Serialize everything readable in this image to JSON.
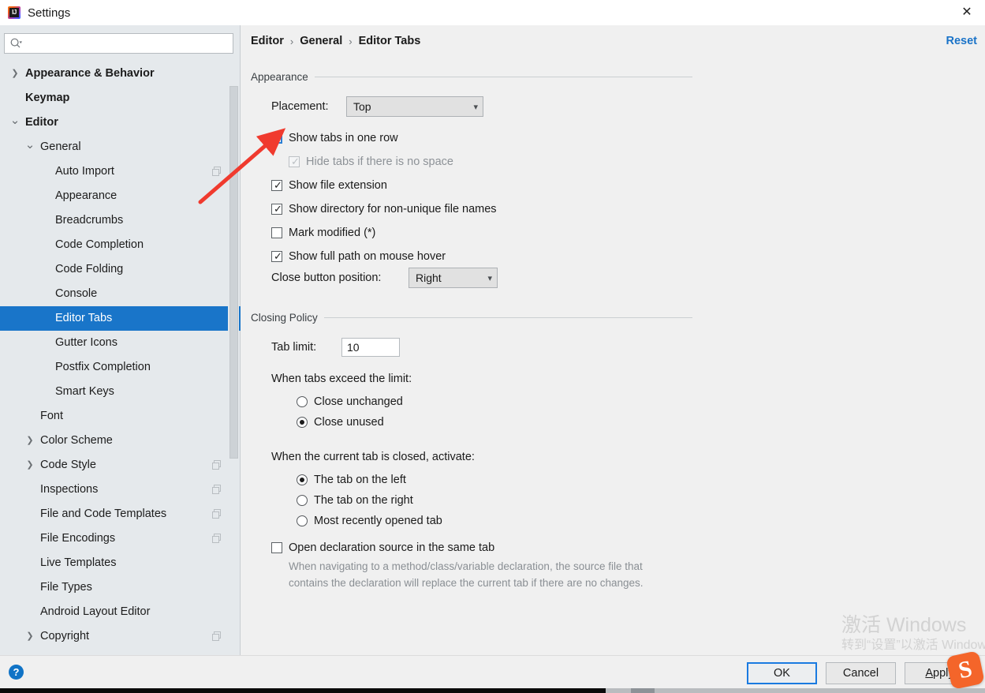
{
  "window": {
    "title": "Settings",
    "app_icon": "intellij-idea-icon",
    "close_icon": "close-icon"
  },
  "search": {
    "value": "",
    "placeholder": "",
    "icon": "search-icon",
    "dropdown_icon": "chevron-down-icon"
  },
  "sidebar": {
    "items": [
      {
        "label": "Appearance & Behavior",
        "indent": 0,
        "arrow": "chevron-right-icon",
        "bold": true,
        "selected": false,
        "badge": false
      },
      {
        "label": "Keymap",
        "indent": 0,
        "arrow": "",
        "bold": true,
        "selected": false,
        "badge": false
      },
      {
        "label": "Editor",
        "indent": 0,
        "arrow": "chevron-down-icon",
        "bold": true,
        "selected": false,
        "badge": false
      },
      {
        "label": "General",
        "indent": 1,
        "arrow": "chevron-down-icon",
        "bold": false,
        "selected": false,
        "badge": false
      },
      {
        "label": "Auto Import",
        "indent": 2,
        "arrow": "",
        "bold": false,
        "selected": false,
        "badge": true
      },
      {
        "label": "Appearance",
        "indent": 2,
        "arrow": "",
        "bold": false,
        "selected": false,
        "badge": false
      },
      {
        "label": "Breadcrumbs",
        "indent": 2,
        "arrow": "",
        "bold": false,
        "selected": false,
        "badge": false
      },
      {
        "label": "Code Completion",
        "indent": 2,
        "arrow": "",
        "bold": false,
        "selected": false,
        "badge": false
      },
      {
        "label": "Code Folding",
        "indent": 2,
        "arrow": "",
        "bold": false,
        "selected": false,
        "badge": false
      },
      {
        "label": "Console",
        "indent": 2,
        "arrow": "",
        "bold": false,
        "selected": false,
        "badge": false
      },
      {
        "label": "Editor Tabs",
        "indent": 2,
        "arrow": "",
        "bold": false,
        "selected": true,
        "badge": false
      },
      {
        "label": "Gutter Icons",
        "indent": 2,
        "arrow": "",
        "bold": false,
        "selected": false,
        "badge": false
      },
      {
        "label": "Postfix Completion",
        "indent": 2,
        "arrow": "",
        "bold": false,
        "selected": false,
        "badge": false
      },
      {
        "label": "Smart Keys",
        "indent": 2,
        "arrow": "",
        "bold": false,
        "selected": false,
        "badge": false
      },
      {
        "label": "Font",
        "indent": 1,
        "arrow": "",
        "bold": false,
        "selected": false,
        "badge": false
      },
      {
        "label": "Color Scheme",
        "indent": 1,
        "arrow": "chevron-right-icon",
        "bold": false,
        "selected": false,
        "badge": false
      },
      {
        "label": "Code Style",
        "indent": 1,
        "arrow": "chevron-right-icon",
        "bold": false,
        "selected": false,
        "badge": true
      },
      {
        "label": "Inspections",
        "indent": 1,
        "arrow": "",
        "bold": false,
        "selected": false,
        "badge": true
      },
      {
        "label": "File and Code Templates",
        "indent": 1,
        "arrow": "",
        "bold": false,
        "selected": false,
        "badge": true
      },
      {
        "label": "File Encodings",
        "indent": 1,
        "arrow": "",
        "bold": false,
        "selected": false,
        "badge": true
      },
      {
        "label": "Live Templates",
        "indent": 1,
        "arrow": "",
        "bold": false,
        "selected": false,
        "badge": false
      },
      {
        "label": "File Types",
        "indent": 1,
        "arrow": "",
        "bold": false,
        "selected": false,
        "badge": false
      },
      {
        "label": "Android Layout Editor",
        "indent": 1,
        "arrow": "",
        "bold": false,
        "selected": false,
        "badge": false
      },
      {
        "label": "Copyright",
        "indent": 1,
        "arrow": "chevron-right-icon",
        "bold": false,
        "selected": false,
        "badge": true
      }
    ]
  },
  "content": {
    "breadcrumb": [
      "Editor",
      "General",
      "Editor Tabs"
    ],
    "breadcrumb_separator": "›",
    "reset_label": "Reset",
    "appearance": {
      "group_title": "Appearance",
      "placement_label": "Placement:",
      "placement_value": "Top",
      "close_button_label": "Close button position:",
      "close_button_value": "Right",
      "checkboxes": [
        {
          "label": "Show tabs in one row",
          "checked": false,
          "disabled": false,
          "focused": true,
          "indented": false
        },
        {
          "label": "Hide tabs if there is no space",
          "checked": true,
          "disabled": true,
          "focused": false,
          "indented": true
        },
        {
          "label": "Show file extension",
          "checked": true,
          "disabled": false,
          "focused": false,
          "indented": false
        },
        {
          "label": "Show directory for non-unique file names",
          "checked": true,
          "disabled": false,
          "focused": false,
          "indented": false
        },
        {
          "label": "Mark modified (*)",
          "checked": false,
          "disabled": false,
          "focused": false,
          "indented": false
        },
        {
          "label": "Show full path on mouse hover",
          "checked": true,
          "disabled": false,
          "focused": false,
          "indented": false
        }
      ]
    },
    "closing_policy": {
      "group_title": "Closing Policy",
      "tab_limit_label": "Tab limit:",
      "tab_limit_value": "10",
      "exceed_label": "When tabs exceed the limit:",
      "exceed_options": [
        {
          "label": "Close unchanged",
          "selected": false
        },
        {
          "label": "Close unused",
          "selected": true
        }
      ],
      "activate_label": "When the current tab is closed, activate:",
      "activate_options": [
        {
          "label": "The tab on the left",
          "selected": true
        },
        {
          "label": "The tab on the right",
          "selected": false
        },
        {
          "label": "Most recently opened tab",
          "selected": false
        }
      ],
      "open_declaration": {
        "label": "Open declaration source in the same tab",
        "checked": false,
        "description": "When navigating to a method/class/variable declaration, the source file that contains the declaration will replace the current tab if there are no changes."
      }
    }
  },
  "footer": {
    "help_icon": "help-question-icon",
    "help_label": "?",
    "ok_label": "OK",
    "cancel_label": "Cancel",
    "apply_mnemonic": "A",
    "apply_rest": "pply"
  },
  "watermark": {
    "line1": "激活 Windows",
    "line2": "转到“设置”以激活 Windows"
  },
  "overlay": {
    "sogou_logo": "S"
  },
  "colors": {
    "accent_blue": "#1975c9",
    "link_blue": "#1a73c8",
    "sidebar_bg": "#e5e9ec",
    "content_bg": "#f0f0f0",
    "annotation_red": "#f03a2e"
  }
}
